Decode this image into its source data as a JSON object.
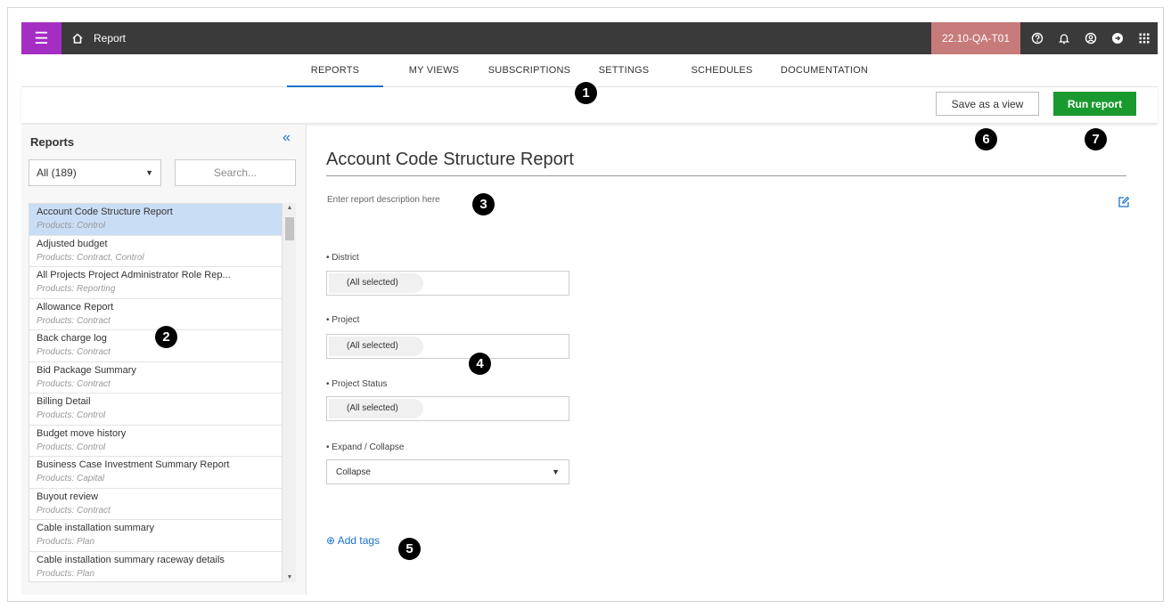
{
  "topbar": {
    "menu_icon": "hamburger-icon",
    "home_icon": "home-icon",
    "app_title": "Report",
    "env_badge": "22.10-QA-T01",
    "icons": [
      "help-icon",
      "bell-icon",
      "user-icon",
      "logout-icon",
      "apps-grid-icon"
    ]
  },
  "tabs": [
    {
      "label": "REPORTS",
      "active": true
    },
    {
      "label": "MY VIEWS",
      "active": false
    },
    {
      "label": "SUBSCRIPTIONS",
      "active": false
    },
    {
      "label": "SETTINGS",
      "active": false
    },
    {
      "label": "SCHEDULES",
      "active": false
    },
    {
      "label": "DOCUMENTATION",
      "active": false
    }
  ],
  "actions": {
    "save_view": "Save as a view",
    "run_report": "Run report"
  },
  "sidebar": {
    "title": "Reports",
    "filter_value": "All (189)",
    "search_placeholder": "Search...",
    "items": [
      {
        "name": "Account Code Structure Report",
        "products": "Products: Control",
        "selected": true
      },
      {
        "name": "Adjusted budget",
        "products": "Products: Contract, Control",
        "selected": false
      },
      {
        "name": "All Projects Project Administrator Role Rep...",
        "products": "Products: Reporting",
        "selected": false
      },
      {
        "name": "Allowance Report",
        "products": "Products: Contract",
        "selected": false
      },
      {
        "name": "Back charge log",
        "products": "Products: Contract",
        "selected": false
      },
      {
        "name": "Bid Package Summary",
        "products": "Products: Contract",
        "selected": false
      },
      {
        "name": "Billing Detail",
        "products": "Products: Control",
        "selected": false
      },
      {
        "name": "Budget move history",
        "products": "Products: Control",
        "selected": false
      },
      {
        "name": "Business Case Investment Summary Report",
        "products": "Products: Capital",
        "selected": false
      },
      {
        "name": "Buyout review",
        "products": "Products: Contract",
        "selected": false
      },
      {
        "name": "Cable installation summary",
        "products": "Products: Plan",
        "selected": false
      },
      {
        "name": "Cable installation summary raceway details",
        "products": "Products: Plan",
        "selected": false
      }
    ]
  },
  "report": {
    "title": "Account Code Structure Report",
    "description_placeholder": "Enter report description here",
    "fields": [
      {
        "label": "• District",
        "value": "(All selected)"
      },
      {
        "label": "• Project",
        "value": "(All selected)"
      },
      {
        "label": "• Project Status",
        "value": "(All selected)"
      }
    ],
    "expand_collapse": {
      "label": "• Expand / Collapse",
      "value": "Collapse"
    },
    "add_tags": "⊕ Add tags"
  },
  "callouts": [
    "1",
    "2",
    "3",
    "4",
    "5",
    "6",
    "7"
  ],
  "colors": {
    "menu_purple": "#a42ec4",
    "topbar": "#3a3a3a",
    "env_badge": "#c77a7a",
    "run_green": "#1a9a2e",
    "accent_blue": "#1a73c8",
    "selected_row": "#c9ddf5"
  }
}
